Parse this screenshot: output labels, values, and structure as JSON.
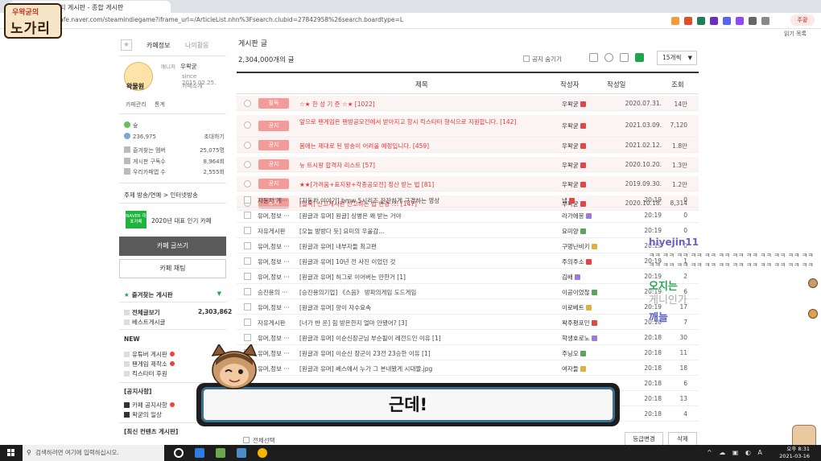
{
  "browser": {
    "tab_title": "커뮤니티 게시판 - 종합 게시판",
    "url": "cafe.naver.com/steamindiegame?iframe_url=/ArticleList.nhn%3Fsearch.clubid=27842958%26search.boardtype=L",
    "profile_label": "주황",
    "reading_list": "읽기 목록"
  },
  "overlay_logo": {
    "sub": "우왁굳의",
    "main": "노가리"
  },
  "sidebar": {
    "tabs": [
      "카페정보",
      "나의활동"
    ],
    "manager_role": "매니저",
    "manager_name": "우왁굳",
    "since": "since 2015.02.25.",
    "cafe_intro": "카페소개",
    "manager_avatar_label": "왁물원",
    "links": [
      "카페관리",
      "통계"
    ],
    "grade": "숲",
    "members": {
      "count": "236,975",
      "action": "초대하기"
    },
    "stats": [
      {
        "label": "즐겨찾는 멤버",
        "value": "25,075명"
      },
      {
        "label": "게시판 구독수",
        "value": "8,964회"
      },
      {
        "label": "우리카페앱 수",
        "value": "2,555회"
      }
    ],
    "topic": "주제  방송/연예 > 인터넷방송",
    "naver_badge": "NAVER 대표카페",
    "award": "2020년 대표 인기 카페",
    "write_button": "카페 글쓰기",
    "chat_button": "카페 채팅",
    "favorites_title": "즐겨찾는 게시판",
    "menu": [
      {
        "label": "전체글보기",
        "count": "2,303,862",
        "bold": true
      },
      {
        "label": "베스트게시글",
        "count": ""
      }
    ],
    "new_title": "NEW",
    "new_items": [
      "유튜버 게시판",
      "팬게임 제작소",
      "킥스타터 후원"
    ],
    "notice_section": "[공지사항]",
    "notice_items": [
      "카페 공지사항",
      "왁굳의 일상"
    ],
    "recent_section": "[최신 컨텐츠 게시판]"
  },
  "board": {
    "title_partial": "게시판 글",
    "total": "2,304,000개의 글",
    "notice_toggle": "공지 숨기기",
    "per_page": "15개씩",
    "columns": {
      "subject": "제목",
      "author": "작성자",
      "date": "작성일",
      "views": "조회"
    },
    "notices": [
      {
        "tag": "필독",
        "subject": "☆★ 한 성 기 준 ☆★ [1022]",
        "author": "우왁굳",
        "date": "2020.07.31.",
        "views": "14만"
      },
      {
        "tag": "공지",
        "subject": "앞으로 팬게임은 팬방공모전에서 받아지고 항시 킥스타터 형식으로 지원합니다. [142]",
        "author": "우왁굳",
        "date": "2021.03.09.",
        "views": "7,120"
      },
      {
        "tag": "공지",
        "subject": "봄에는 제대로 된 방송이 어려울 예정입니다. [459]",
        "author": "우왁굳",
        "date": "2021.02.12.",
        "views": "1.8만"
      },
      {
        "tag": "공지",
        "subject": "뉴 트시왕 합격자 리스트 [57]",
        "author": "우왁굳",
        "date": "2020.10.20.",
        "views": "1.3만"
      },
      {
        "tag": "공지",
        "subject": "★★[가려움+표지왕+각종공모전] 정산 받는 법 [81]",
        "author": "우왁굳",
        "date": "2019.09.30.",
        "views": "1.2만"
      },
      {
        "tag": "공지",
        "subject": "[필독] 신고게시판 신고하는 법 변경 !!! [147]",
        "author": "우왁굳",
        "date": "2020.10.18.",
        "views": "8,314"
      }
    ],
    "posts": [
      {
        "board": "자동차 게···",
        "subject": "[자동차 이야기] bmw 5시리즈 잔잔하게 구경하는 영상",
        "author": "냅",
        "date": "20:19",
        "views": "0"
      },
      {
        "board": "유머,정보 ···",
        "subject": "[원글과 유머] 원글] 상병은 왜 받는 거야",
        "author": "라가에몽",
        "date": "20:19",
        "views": "0"
      },
      {
        "board": "자유게시판",
        "subject": "[오늘 방방다 듯] 요미의 우울감... ",
        "author": "요미양",
        "date": "20:19",
        "views": "0"
      },
      {
        "board": "유머,정보 ···",
        "subject": "[원글과 유머] 내부자들 최고편",
        "author": "구멍난비키",
        "date": "20:19",
        "views": "0"
      },
      {
        "board": "유머,정보 ···",
        "subject": "[원글과 유머] 10년 전 사진 이었던 것",
        "author": "주의주소",
        "date": "20:19",
        "views": "1"
      },
      {
        "board": "유머,정보 ···",
        "subject": "[원글과 유머] 허그로 이어버는 만한거 [1]",
        "author": "김배",
        "date": "20:19",
        "views": "2"
      },
      {
        "board": "승진용의 ···",
        "subject": "[승진용의기업] 《스음》 방파의게임 도드게임",
        "author": "이공이었잖",
        "date": "20:19",
        "views": "6"
      },
      {
        "board": "유머,정보 ···",
        "subject": "[원글과 유머] 팡이 자수요속",
        "author": "이로베트",
        "date": "20:19",
        "views": "17"
      },
      {
        "board": "자유게시판",
        "subject": "[너가 반 운] 힘 방은한지 얼마 안됐어? [3]",
        "author": "왁주평포인",
        "date": "20:18",
        "views": "7"
      },
      {
        "board": "유머,정보 ···",
        "subject": "[원글과 유머] 이순신장군님 부순될이 레전드인 이유 [1]",
        "author": "학생호로노",
        "date": "20:18",
        "views": "30"
      },
      {
        "board": "유머,정보 ···",
        "subject": "[원글과 유머] 이순신 장군이 23전 23승한 이유 [1]",
        "author": "주닝오",
        "date": "20:18",
        "views": "11"
      },
      {
        "board": "유머,정보 ···",
        "subject": "[원글과 유머] 베스에서 누가 그 본내봤게 시대짤.jpg",
        "author": "여자들",
        "date": "20:18",
        "views": "18"
      },
      {
        "board": "",
        "subject": "",
        "author": "",
        "date": "20:18",
        "views": "6"
      },
      {
        "board": "",
        "subject": "",
        "author": "",
        "date": "20:18",
        "views": "13"
      },
      {
        "board": "",
        "subject": "",
        "author": "",
        "date": "20:18",
        "views": "4"
      }
    ],
    "select_all": "전체선택",
    "grade_change": "등급변경",
    "delete": "삭제"
  },
  "chat": {
    "username": "hiyejin11",
    "spam": "ㅋㅋ ㅋㅋ ㅋㅋ ㅋㅋ ㅋㅋ ㅋㅋ ㅋㅋ ㅋㅋ ㅋㅋ ㅋㅋ ㅋㅋ ㅋㅋ ㅋㅋ ㅋㅋ ㅋㅋ ㅋㅋ ㅋㅋ ㅋㅋ ㅋㅋ ㅋㅋ ㅋㅋ ㅋㅋ ㅋㅋ ㅋㅋ",
    "msg1": "오지는",
    "msg2": "게니인가",
    "msg3": "깨늘"
  },
  "caption": {
    "text": "근데!"
  },
  "taskbar": {
    "search_placeholder": "검색하려면 여기에 입력하십시오.",
    "time": "오후 8:31",
    "date": "2021-03-16"
  },
  "colors": {
    "accent_green": "#1fa64a",
    "notice_tag": "#f39a9a",
    "notice_text": "#e03a3a",
    "caption_border": "#3b6e8f"
  }
}
